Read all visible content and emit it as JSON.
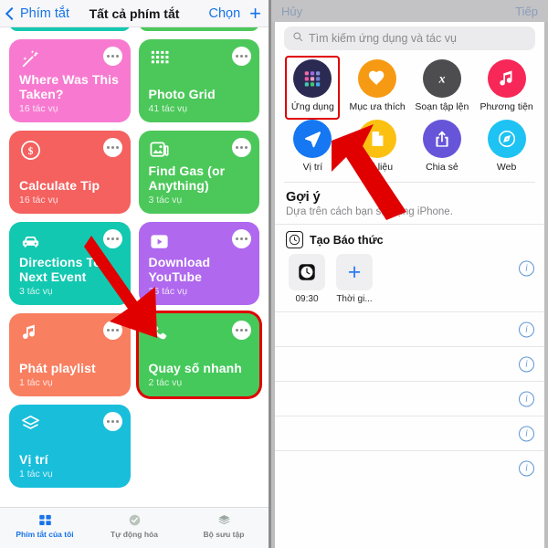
{
  "left": {
    "nav": {
      "back_label": "Phím tắt",
      "title": "Tất cả phím tắt",
      "choose_label": "Chọn",
      "add_label": "+"
    },
    "cards": [
      {
        "title": "",
        "subtitle": "",
        "color": "#13c8b0",
        "icon": "none",
        "stub": true,
        "selected": false
      },
      {
        "title": "",
        "subtitle": "",
        "color": "#4cc85a",
        "icon": "none",
        "stub": true,
        "selected": false
      },
      {
        "title": "Where Was This Taken?",
        "subtitle": "16 tác vụ",
        "color": "#f77ad0",
        "icon": "magic-wand-icon",
        "stub": false,
        "selected": false
      },
      {
        "title": "Photo Grid",
        "subtitle": "41 tác vụ",
        "color": "#4cc85a",
        "icon": "grid-dots-icon",
        "stub": false,
        "selected": false
      },
      {
        "title": "Calculate Tip",
        "subtitle": "16 tác vụ",
        "color": "#f4615f",
        "icon": "dollar-icon",
        "stub": false,
        "selected": false
      },
      {
        "title": "Find Gas (or Anything)",
        "subtitle": "3 tác vụ",
        "color": "#4cc85a",
        "icon": "gas-photo-icon",
        "stub": false,
        "selected": false
      },
      {
        "title": "Directions To Next Event",
        "subtitle": "3 tác vụ",
        "color": "#13c8b0",
        "icon": "car-icon",
        "stub": false,
        "selected": false
      },
      {
        "title": "Download YouTube",
        "subtitle": "36 tác vụ",
        "color": "#b068ef",
        "icon": "play-icon",
        "stub": false,
        "selected": false
      },
      {
        "title": "Phát playlist",
        "subtitle": "1 tác vụ",
        "color": "#f97f61",
        "icon": "music-note-icon",
        "stub": false,
        "selected": false
      },
      {
        "title": "Quay số nhanh",
        "subtitle": "2 tác vụ",
        "color": "#45c котор",
        "icon": "phone-icon",
        "stub": false,
        "selected": true
      },
      {
        "title": "Vị trí",
        "subtitle": "1 tác vụ",
        "color": "#19bedb",
        "icon": "layers-icon",
        "stub": false,
        "selected": false
      }
    ],
    "tabs": [
      {
        "label": "Phím tắt của tôi",
        "icon": "squares-icon",
        "active": true
      },
      {
        "label": "Tự động hóa",
        "icon": "clock-check-icon",
        "active": false
      },
      {
        "label": "Bộ sưu tập",
        "icon": "layers-icon",
        "active": false
      }
    ]
  },
  "right": {
    "topbar": {
      "cancel_label": "Hủy",
      "next_label": "Tiếp"
    },
    "search": {
      "placeholder": "Tìm kiếm ứng dụng và tác vụ",
      "value": ""
    },
    "categories": [
      {
        "label": "Ứng dụng",
        "icon": "app-grid-icon",
        "color": "#2b2a52",
        "selected": true
      },
      {
        "label": "Mục ưa thích",
        "icon": "heart-icon",
        "color": "#f79a13",
        "selected": false
      },
      {
        "label": "Soạn tập lện",
        "icon": "x-script-icon",
        "color": "#4d4d4f",
        "selected": false
      },
      {
        "label": "Phương tiện",
        "icon": "music-note-icon",
        "color": "#f72757",
        "selected": false
      },
      {
        "label": "Vị trí",
        "icon": "navigation-icon",
        "color": "#1577f2",
        "selected": false
      },
      {
        "label": "Tài liệu",
        "icon": "document-icon",
        "color": "#fcc011",
        "selected": false
      },
      {
        "label": "Chia sẻ",
        "icon": "share-icon",
        "color": "#6655d9",
        "selected": false
      },
      {
        "label": "Web",
        "icon": "safari-compass-icon",
        "color": "#1ec2f3",
        "selected": false
      }
    ],
    "suggestions": {
      "title": "Gợi ý",
      "subtitle": "Dựa trên cách bạn sử dụng iPhone."
    },
    "rows": [
      {
        "title": "Tạo Báo thức",
        "icon": "clock-icon",
        "info": "i",
        "params": [
          {
            "label": "09:30",
            "icon": "clock-icon"
          },
          {
            "label": "Thời gi...",
            "icon": "plus-icon"
          }
        ]
      },
      {
        "title": "",
        "icon": "",
        "info": "i",
        "params": []
      },
      {
        "title": "",
        "icon": "",
        "info": "i",
        "params": []
      },
      {
        "title": "",
        "icon": "",
        "info": "i",
        "params": []
      },
      {
        "title": "",
        "icon": "",
        "info": "i",
        "params": []
      },
      {
        "title": "",
        "icon": "",
        "info": "i",
        "params": []
      }
    ]
  },
  "annotations": {
    "arrow_color": "#e00000",
    "highlight_color": "#e00000"
  }
}
